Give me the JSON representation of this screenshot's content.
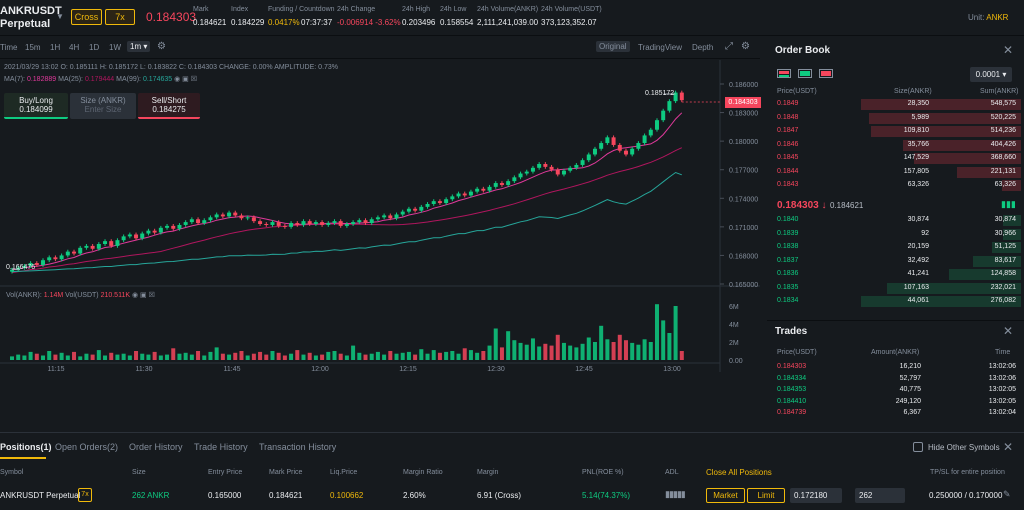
{
  "header": {
    "symbol_line1": "ANKRUSDT",
    "symbol_line2": "Perpetual",
    "cross_label": "Cross",
    "leverage_label": "7x",
    "last_price": "0.184303",
    "stats": [
      {
        "label": "Mark",
        "value": "0.184621"
      },
      {
        "label": "Index",
        "value": "0.184229"
      },
      {
        "label": "Funding / Countdown",
        "value1": "0.0417%",
        "value2": "07:37:37"
      },
      {
        "label": "24h Change",
        "value": "-0.006914 -3.62%"
      },
      {
        "label": "24h High",
        "value": "0.203496"
      },
      {
        "label": "24h Low",
        "value": "0.158554"
      },
      {
        "label": "24h Volume(ANKR)",
        "value": "2,111,241,039.00"
      },
      {
        "label": "24h Volume(USDT)",
        "value": "373,123,352.07"
      }
    ],
    "unit_label": "Unit: ",
    "unit_value": "ANKR"
  },
  "chart_toolbar": {
    "intervals": [
      "Time",
      "15m",
      "1H",
      "4H",
      "1D",
      "1W",
      "1m"
    ],
    "active_interval": "1m",
    "views": [
      "Original",
      "TradingView",
      "Depth"
    ],
    "active_view": "Original"
  },
  "chart_info": {
    "ohlc_line": "2021/03/29 13:02  O: 0.185111  H: 0.185172  L: 0.183822  C: 0.184303  CHANGE: 0.00%  AMPLITUDE: 0.73%",
    "ma7_label": "MA(7): ",
    "ma7_value": "0.182889",
    "ma25_label": "MA(25): ",
    "ma25_value": "0.179444",
    "ma99_label": "MA(99): ",
    "ma99_value": "0.174635",
    "vol_label": "Vol(ANKR): ",
    "vol_ankr": "1.14M",
    "vol_usdt_label": "Vol(USDT) ",
    "vol_usdt": "210.511K",
    "high_marker": "0.185172",
    "low_marker": "0.166476",
    "price_tag": "0.184303"
  },
  "order_buttons": {
    "buy_label": "Buy/Long",
    "buy_price": "0.184099",
    "size_label": "Size (ANKR)",
    "size_placeholder": "Enter Size",
    "sell_label": "Sell/Short",
    "sell_price": "0.184275"
  },
  "chart_data": {
    "type": "candlestick",
    "y_axis_ticks": [
      "0.186000",
      "0.183000",
      "0.180000",
      "0.177000",
      "0.174000",
      "0.171000",
      "0.168000",
      "0.165000"
    ],
    "x_axis_ticks": [
      "11:15",
      "11:30",
      "11:45",
      "12:00",
      "12:15",
      "12:30",
      "12:45",
      "13:00"
    ],
    "volume_ticks": [
      "6M",
      "4M",
      "2M",
      "0.00"
    ],
    "ylim": [
      0.165,
      0.186
    ],
    "close_series": [
      0.1665,
      0.1667,
      0.1669,
      0.1672,
      0.167,
      0.1675,
      0.1678,
      0.1676,
      0.168,
      0.1684,
      0.1682,
      0.1688,
      0.169,
      0.1687,
      0.1692,
      0.1695,
      0.169,
      0.1696,
      0.17,
      0.1702,
      0.1698,
      0.1703,
      0.1706,
      0.1704,
      0.1709,
      0.1711,
      0.1708,
      0.1712,
      0.1715,
      0.1718,
      0.1714,
      0.1717,
      0.172,
      0.1723,
      0.1721,
      0.1725,
      0.1722,
      0.1719,
      0.172,
      0.1716,
      0.1713,
      0.1712,
      0.1715,
      0.1711,
      0.171,
      0.1714,
      0.1712,
      0.1716,
      0.1713,
      0.1715,
      0.1712,
      0.1714,
      0.1716,
      0.1711,
      0.1713,
      0.1715,
      0.1717,
      0.1714,
      0.1718,
      0.172,
      0.1722,
      0.1719,
      0.1723,
      0.1726,
      0.1729,
      0.1727,
      0.1731,
      0.1734,
      0.1737,
      0.1735,
      0.1739,
      0.1742,
      0.1745,
      0.1743,
      0.1747,
      0.175,
      0.1748,
      0.1752,
      0.1756,
      0.1754,
      0.1758,
      0.1762,
      0.1766,
      0.1768,
      0.1772,
      0.1776,
      0.1773,
      0.177,
      0.1765,
      0.1769,
      0.1772,
      0.1775,
      0.178,
      0.1786,
      0.1792,
      0.1798,
      0.1804,
      0.1796,
      0.179,
      0.1786,
      0.1792,
      0.1798,
      0.1806,
      0.1812,
      0.1822,
      0.1832,
      0.1842,
      0.1851,
      0.1843
    ],
    "ma7_series_note": "",
    "volume_series": [
      0.4,
      0.6,
      0.5,
      0.9,
      0.7,
      0.5,
      1.0,
      0.6,
      0.8,
      0.5,
      0.9,
      0.4,
      0.7,
      0.6,
      1.1,
      0.5,
      0.8,
      0.6,
      0.7,
      0.5,
      1.0,
      0.7,
      0.6,
      0.9,
      0.5,
      0.6,
      1.3,
      0.7,
      0.8,
      0.6,
      1.0,
      0.5,
      0.9,
      1.4,
      0.7,
      0.6,
      0.8,
      1.0,
      0.5,
      0.7,
      0.9,
      0.6,
      1.0,
      0.8,
      0.5,
      0.7,
      1.1,
      0.6,
      0.8,
      0.5,
      0.6,
      0.9,
      1.0,
      0.7,
      0.5,
      1.6,
      0.8,
      0.6,
      0.7,
      0.9,
      0.6,
      1.0,
      0.7,
      0.8,
      0.9,
      0.6,
      1.2,
      0.7,
      1.1,
      0.8,
      0.9,
      1.0,
      0.7,
      1.3,
      1.1,
      0.8,
      1.0,
      1.6,
      3.5,
      1.4,
      3.2,
      2.2,
      1.9,
      1.7,
      2.4,
      1.5,
      1.8,
      1.6,
      2.8,
      1.9,
      1.6,
      1.4,
      1.8,
      2.5,
      2.0,
      3.8,
      2.3,
      2.0,
      2.8,
      2.2,
      1.9,
      1.7,
      2.3,
      2.0,
      6.2,
      4.4,
      3.0,
      6.0,
      1.0
    ]
  },
  "order_book": {
    "title": "Order Book",
    "precision": "0.0001",
    "headers": [
      "Price(USDT)",
      "Size(ANKR)",
      "Sum(ANKR)"
    ],
    "asks": [
      {
        "price": "0.1849",
        "size": "28,350",
        "sum": "548,575",
        "depth": 1.0
      },
      {
        "price": "0.1848",
        "size": "5,989",
        "sum": "520,225",
        "depth": 0.95
      },
      {
        "price": "0.1847",
        "size": "109,810",
        "sum": "514,236",
        "depth": 0.94
      },
      {
        "price": "0.1846",
        "size": "35,766",
        "sum": "404,426",
        "depth": 0.74
      },
      {
        "price": "0.1845",
        "size": "147,529",
        "sum": "368,660",
        "depth": 0.67
      },
      {
        "price": "0.1844",
        "size": "157,805",
        "sum": "221,131",
        "depth": 0.4
      },
      {
        "price": "0.1843",
        "size": "63,326",
        "sum": "63,326",
        "depth": 0.12
      }
    ],
    "mid_price": "0.184303",
    "mid_arrow": "↓",
    "mid_mark": "0.184621",
    "bids": [
      {
        "price": "0.1840",
        "size": "30,874",
        "sum": "30,874",
        "depth": 0.11
      },
      {
        "price": "0.1839",
        "size": "92",
        "sum": "30,966",
        "depth": 0.11
      },
      {
        "price": "0.1838",
        "size": "20,159",
        "sum": "51,125",
        "depth": 0.18
      },
      {
        "price": "0.1837",
        "size": "32,492",
        "sum": "83,617",
        "depth": 0.3
      },
      {
        "price": "0.1836",
        "size": "41,241",
        "sum": "124,858",
        "depth": 0.45
      },
      {
        "price": "0.1835",
        "size": "107,163",
        "sum": "232,021",
        "depth": 0.84
      },
      {
        "price": "0.1834",
        "size": "44,061",
        "sum": "276,082",
        "depth": 1.0
      }
    ]
  },
  "trades": {
    "title": "Trades",
    "headers": [
      "Price(USDT)",
      "Amount(ANKR)",
      "Time"
    ],
    "rows": [
      {
        "price": "0.184303",
        "amount": "16,210",
        "time": "13:02:06",
        "side": "sell"
      },
      {
        "price": "0.184334",
        "amount": "52,797",
        "time": "13:02:06",
        "side": "buy"
      },
      {
        "price": "0.184353",
        "amount": "40,775",
        "time": "13:02:05",
        "side": "buy"
      },
      {
        "price": "0.184410",
        "amount": "249,120",
        "time": "13:02:05",
        "side": "buy"
      },
      {
        "price": "0.184739",
        "amount": "6,367",
        "time": "13:02:04",
        "side": "sell"
      }
    ]
  },
  "positions": {
    "tabs": [
      "Positions(1)",
      "Open Orders(2)",
      "Order History",
      "Trade History",
      "Transaction History"
    ],
    "hide_other_label": "Hide Other Symbols",
    "columns": [
      "Symbol",
      "Size",
      "Entry Price",
      "Mark Price",
      "Liq.Price",
      "Margin Ratio",
      "Margin",
      "PNL(ROE %)",
      "ADL",
      "Close All Positions",
      "TP/SL for entire position"
    ],
    "row": {
      "symbol": "ANKRUSDT Perpetual",
      "leverage": "7x",
      "size": "262 ANKR",
      "entry": "0.165000",
      "mark": "0.184621",
      "liq": "0.100662",
      "margin_ratio": "2.60%",
      "margin": "6.91 (Cross)",
      "pnl": "5.14(74.37%)",
      "market_btn": "Market",
      "limit_btn": "Limit",
      "price_input": "0.172180",
      "qty_input": "262",
      "tpsl": "0.250000 / 0.170000"
    }
  },
  "colors": {
    "up": "#0ecb81",
    "down": "#f6465d",
    "accent": "#f0b90b",
    "ma7": "#e0399b",
    "ma25": "#b0165e",
    "ma99": "#26a69a"
  }
}
